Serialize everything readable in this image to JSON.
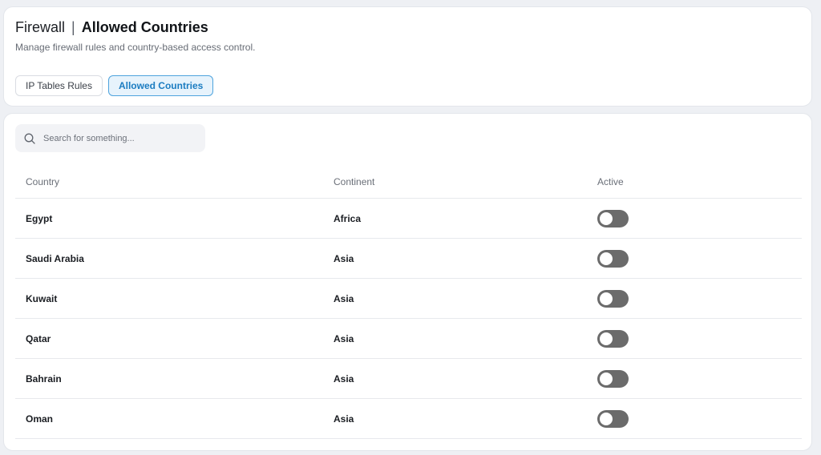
{
  "header": {
    "section": "Firewall",
    "separator": "|",
    "page_title": "Allowed Countries",
    "subtitle": "Manage firewall rules and country-based access control."
  },
  "tabs": [
    {
      "label": "IP Tables Rules",
      "active": false
    },
    {
      "label": "Allowed Countries",
      "active": true
    }
  ],
  "search": {
    "placeholder": "Search for something...",
    "value": ""
  },
  "table": {
    "columns": [
      "Country",
      "Continent",
      "Active"
    ],
    "rows": [
      {
        "country": "Egypt",
        "continent": "Africa",
        "active": false
      },
      {
        "country": "Saudi Arabia",
        "continent": "Asia",
        "active": false
      },
      {
        "country": "Kuwait",
        "continent": "Asia",
        "active": false
      },
      {
        "country": "Qatar",
        "continent": "Asia",
        "active": false
      },
      {
        "country": "Bahrain",
        "continent": "Asia",
        "active": false
      },
      {
        "country": "Oman",
        "continent": "Asia",
        "active": false
      }
    ]
  },
  "colors": {
    "accent": "#1b7cc1",
    "toggle_off": "#6b6b6b",
    "card_bg": "#ffffff",
    "page_bg": "#eef0f4"
  },
  "icons": {
    "search": "search-icon"
  }
}
